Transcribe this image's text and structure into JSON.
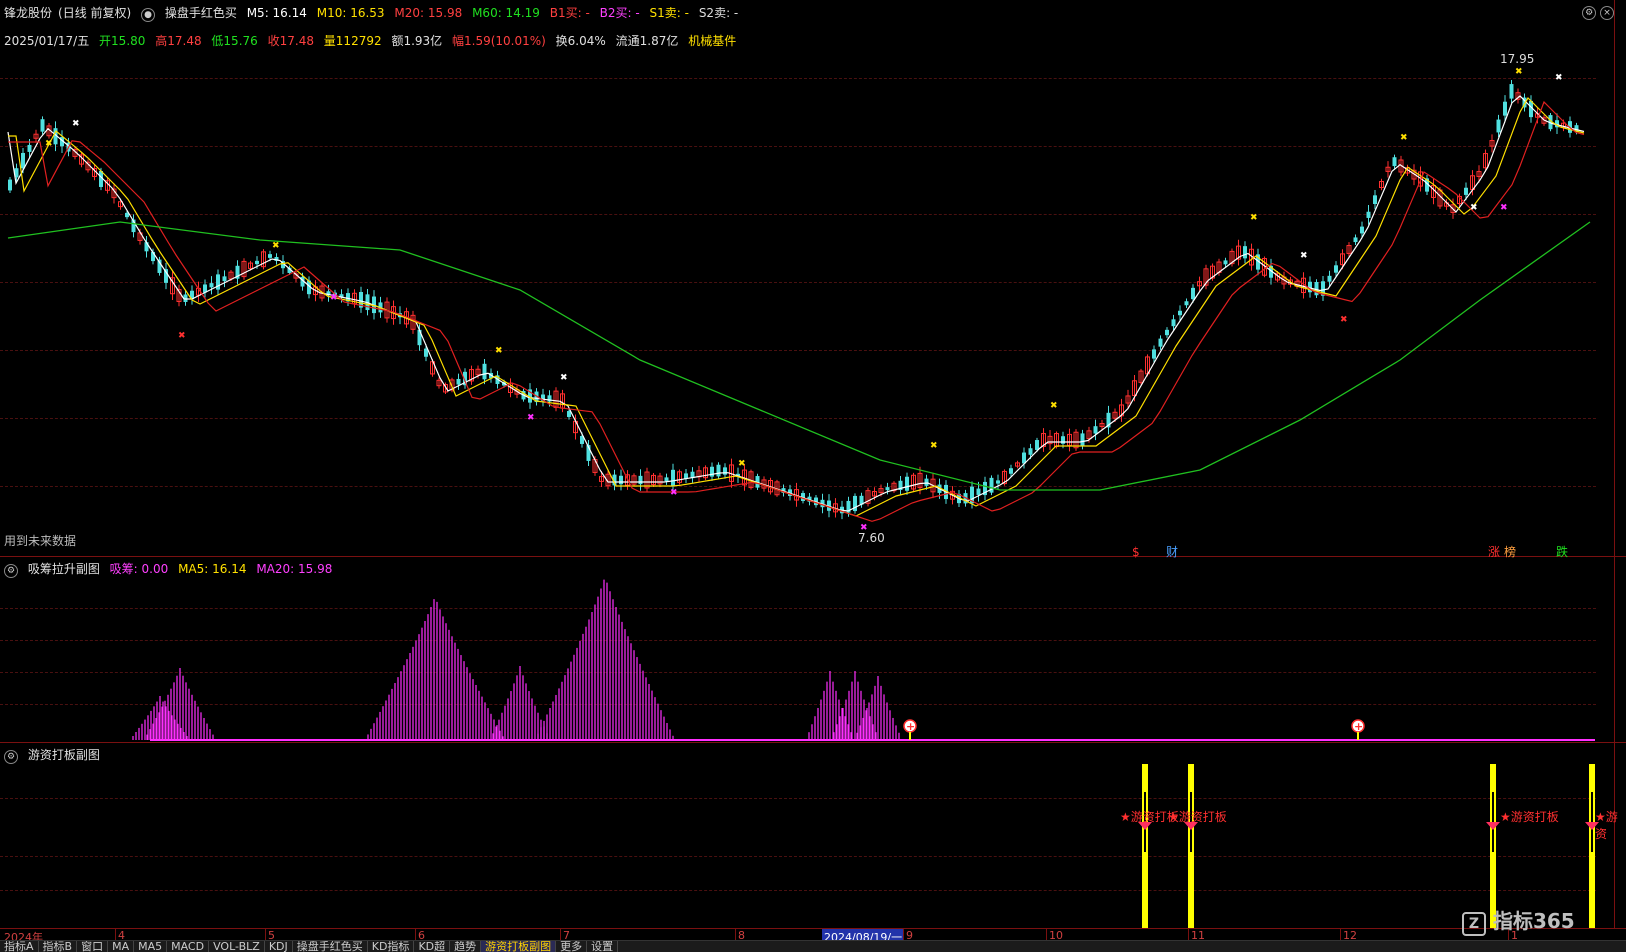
{
  "title_bar": {
    "stock_name": "锋龙股份",
    "period": "(日线 前复权)",
    "indicator": "操盘手红色买",
    "ma5": "M5: 16.14",
    "ma10": "M10: 16.53",
    "ma20": "M20: 15.98",
    "ma60": "M60: 14.19",
    "b1": "B1买: -",
    "b2": "B2买: -",
    "s1": "S1卖: -",
    "s2": "S2卖: -"
  },
  "quote_bar": {
    "date": "2025/01/17/五",
    "open": "开15.80",
    "high": "高17.48",
    "low": "低15.76",
    "close": "收17.48",
    "volume": "量112792",
    "amount": "额1.93亿",
    "change": "幅1.59(10.01%)",
    "turnover": "换6.04%",
    "float": "流通1.87亿",
    "sector": "机械基件"
  },
  "main_chart": {
    "high_label": "17.95",
    "low_label": "7.60",
    "future_data_note": "用到未来数据",
    "event_markers": [
      "$",
      "财",
      "涨",
      "榜",
      "跌"
    ]
  },
  "sub_chart_1": {
    "name": "吸筹拉升副图",
    "xichou": "吸筹: 0.00",
    "ma5": "MA5: 16.14",
    "ma20": "MA20: 15.98"
  },
  "sub_chart_2": {
    "name": "游资打板副图",
    "labels": [
      "★游资打板",
      "★游资打板",
      "★游资打板",
      "★游资"
    ]
  },
  "x_axis": {
    "labels": [
      "2024年",
      "4",
      "5",
      "6",
      "7",
      "8",
      "2024/08/19/一",
      "9",
      "10",
      "11",
      "12",
      "1"
    ]
  },
  "tabs": [
    "指标A",
    "指标B",
    "窗口",
    "MA",
    "MA5",
    "MACD",
    "VOL-BLZ",
    "KDJ",
    "操盘手红色买",
    "KD指标",
    "KD超",
    "趋势",
    "游资打板副图",
    "更多",
    "设置"
  ],
  "watermark": "指标365",
  "colors": {
    "up": "#ff3030",
    "down": "#50e0e0",
    "ma5": "#ffffff",
    "ma10": "#ffe000",
    "ma20": "#e02020",
    "ma60": "#20c020",
    "magenta": "#ff30ff",
    "yellow": "#ffff00"
  }
}
